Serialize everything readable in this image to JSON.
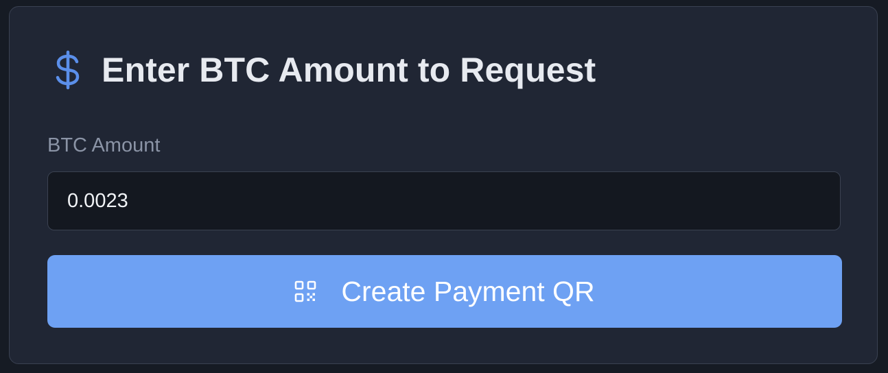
{
  "card": {
    "title": "Enter BTC Amount to Request",
    "title_icon": "dollar-icon",
    "amount_label": "BTC Amount",
    "amount_value": "0.0023",
    "create_button_label": "Create Payment QR",
    "create_button_icon": "qr-code-icon"
  },
  "colors": {
    "background": "#161b24",
    "card_background": "#202634",
    "accent": "#6ea1f3",
    "icon_blue": "#5b8fea",
    "input_background": "#141820"
  }
}
